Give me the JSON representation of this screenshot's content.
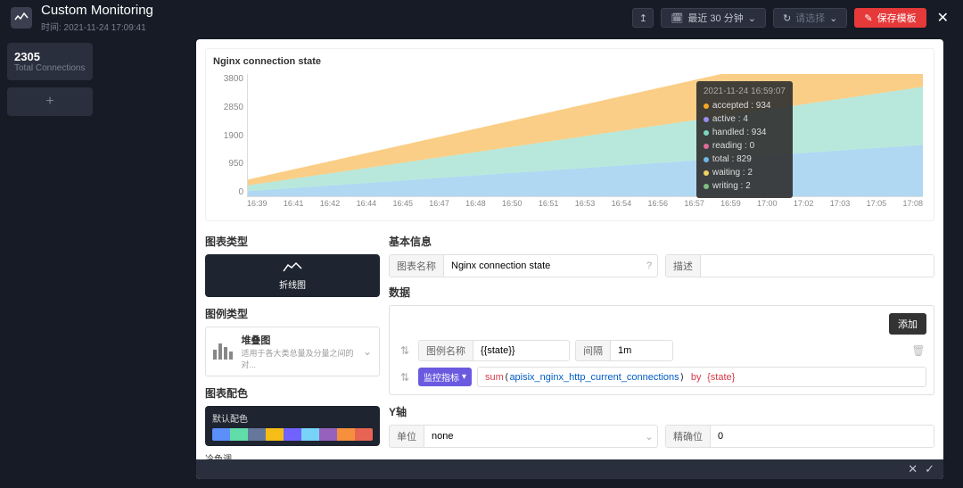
{
  "header": {
    "title": "Custom Monitoring",
    "subtime_label": "时间: 2021-11-24 17:09:41",
    "time_range": "最近 30 分钟",
    "refresh_placeholder": "请选择",
    "save_btn": "保存模板"
  },
  "sidebar": {
    "cards": [
      {
        "value": "2305",
        "label": "Total Connections"
      }
    ]
  },
  "chart_data": {
    "type": "area",
    "title": "Nginx connection state",
    "x": [
      "16:39",
      "16:41",
      "16:42",
      "16:44",
      "16:45",
      "16:47",
      "16:48",
      "16:50",
      "16:51",
      "16:53",
      "16:54",
      "16:56",
      "16:57",
      "16:59",
      "17:00",
      "17:02",
      "17:03",
      "17:05",
      "17:08"
    ],
    "y_ticks": [
      0,
      950,
      1900,
      2850,
      3800
    ],
    "series": [
      {
        "name": "accepted",
        "color": "#f5a623",
        "sample": 934,
        "range": [
          180,
          1800
        ]
      },
      {
        "name": "handled",
        "color": "#7ed6c0",
        "sample": 934,
        "range": [
          180,
          1800
        ]
      },
      {
        "name": "total",
        "color": "#6fb8e8",
        "sample": 829,
        "range": [
          160,
          1600
        ]
      },
      {
        "name": "active",
        "color": "#9b8cf0",
        "sample": 4,
        "range": [
          4,
          4
        ]
      },
      {
        "name": "reading",
        "color": "#e06b9a",
        "sample": 0,
        "range": [
          0,
          0
        ]
      },
      {
        "name": "waiting",
        "color": "#f0d060",
        "sample": 2,
        "range": [
          2,
          2
        ]
      },
      {
        "name": "writing",
        "color": "#80c080",
        "sample": 2,
        "range": [
          2,
          2
        ]
      }
    ],
    "tooltip": {
      "time": "2021-11-24 16:59:07",
      "rows": [
        {
          "label": "accepted",
          "value": "934",
          "color": "#f5a623"
        },
        {
          "label": "active",
          "value": "4",
          "color": "#9b8cf0"
        },
        {
          "label": "handled",
          "value": "934",
          "color": "#7ed6c0"
        },
        {
          "label": "reading",
          "value": "0",
          "color": "#e06b9a"
        },
        {
          "label": "total",
          "value": "829",
          "color": "#6fb8e8"
        },
        {
          "label": "waiting",
          "value": "2",
          "color": "#f0d060"
        },
        {
          "label": "writing",
          "value": "2",
          "color": "#80c080"
        }
      ]
    }
  },
  "config": {
    "sec_chart_type": "图表类型",
    "chart_type_label": "折线图",
    "sec_legend_type": "图例类型",
    "legend_title": "堆叠图",
    "legend_desc": "适用于各大类总量及分量之间的对...",
    "sec_palette": "图表配色",
    "palette1_label": "默认配色",
    "palette1": [
      "#5b8ff9",
      "#61ddaa",
      "#65789b",
      "#f6bd16",
      "#7262fd",
      "#78d3f8",
      "#9661bc",
      "#f6903d",
      "#e86452"
    ],
    "palette2_label": "冷色调",
    "palette2": [
      "#5b8ff9",
      "#6dc8ec",
      "#9ec9ff",
      "#a7e8c8",
      "#b6e388",
      "#ffe06a",
      "#ffc04c"
    ],
    "sec_basic": "基本信息",
    "name_label": "图表名称",
    "name_value": "Nginx connection state",
    "desc_label": "描述",
    "desc_value": "",
    "sec_data": "数据",
    "add_btn": "添加",
    "legend_name_label": "图例名称",
    "legend_name_value": "{{state}}",
    "interval_label": "间隔",
    "interval_value": "1m",
    "metric_label": "监控指标",
    "expr_fn": "sum",
    "expr_id": "apisix_nginx_http_current_connections",
    "expr_by": "by",
    "expr_grp": "{state}",
    "sec_yaxis": "Y轴",
    "unit_label": "单位",
    "unit_value": "none",
    "precision_label": "精确位",
    "precision_value": "0"
  }
}
